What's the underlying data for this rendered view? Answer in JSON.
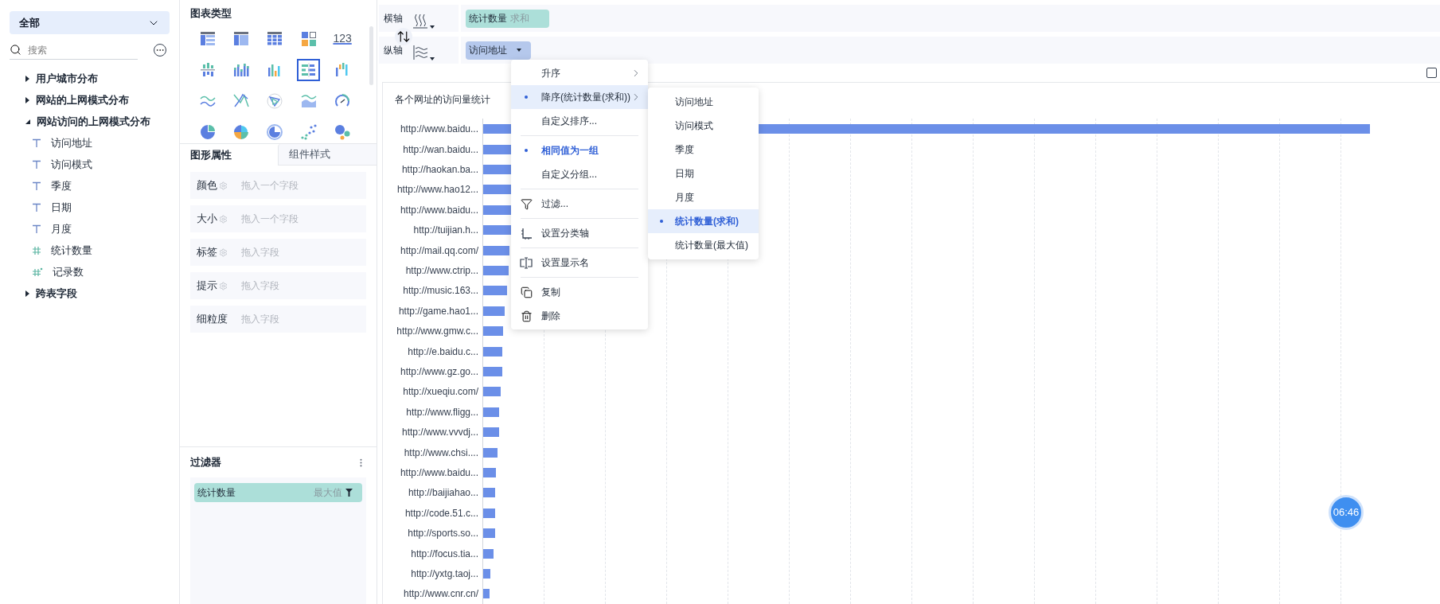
{
  "sidebar": {
    "dropdown": "全部",
    "search": {
      "placeholder": "搜索"
    },
    "tree": [
      {
        "label": "用户城市分布",
        "expanded": false
      },
      {
        "label": "网站的上网模式分布",
        "expanded": false
      },
      {
        "label": "网站访问的上网模式分布",
        "expanded": true,
        "children": [
          {
            "label": "访问地址",
            "kind": "text"
          },
          {
            "label": "访问模式",
            "kind": "text"
          },
          {
            "label": "季度",
            "kind": "text"
          },
          {
            "label": "日期",
            "kind": "text"
          },
          {
            "label": "月度",
            "kind": "text"
          },
          {
            "label": "统计数量",
            "kind": "number"
          },
          {
            "label": "记录数",
            "kind": "calc"
          }
        ]
      },
      {
        "label": "跨表字段",
        "expanded": false
      }
    ]
  },
  "chart_types": {
    "title": "图表类型",
    "items": [
      {
        "kind": "table",
        "selected": false
      },
      {
        "kind": "pivot",
        "selected": false
      },
      {
        "kind": "grid",
        "selected": false
      },
      {
        "kind": "tiles",
        "selected": false
      },
      {
        "kind": "number",
        "text": "123",
        "selected": false
      },
      {
        "kind": "bar-split",
        "selected": false
      },
      {
        "kind": "bar-stack",
        "selected": false
      },
      {
        "kind": "bar",
        "selected": false
      },
      {
        "kind": "hbar",
        "selected": true
      },
      {
        "kind": "waterfall",
        "selected": false
      },
      {
        "kind": "line",
        "selected": false
      },
      {
        "kind": "cross-line",
        "selected": false
      },
      {
        "kind": "radar",
        "selected": false
      },
      {
        "kind": "area",
        "selected": false
      },
      {
        "kind": "gauge",
        "selected": false
      },
      {
        "kind": "pie",
        "selected": false
      },
      {
        "kind": "rose",
        "selected": false
      },
      {
        "kind": "ring",
        "selected": false
      },
      {
        "kind": "scatter",
        "selected": false
      },
      {
        "kind": "bubble",
        "selected": false
      }
    ]
  },
  "tabs": [
    {
      "label": "图形属性",
      "selected": true
    },
    {
      "label": "组件样式",
      "selected": false
    }
  ],
  "properties": [
    {
      "label": "颜色",
      "settings": true,
      "placeholder": "拖入一个字段"
    },
    {
      "label": "大小",
      "settings": true,
      "placeholder": "拖入一个字段"
    },
    {
      "label": "标签",
      "settings": true,
      "placeholder": "拖入字段"
    },
    {
      "label": "提示",
      "settings": true,
      "placeholder": "拖入字段"
    },
    {
      "label": "细粒度",
      "settings": false,
      "placeholder": "拖入字段"
    }
  ],
  "filter": {
    "title": "过滤器",
    "items": [
      {
        "field": "统计数量",
        "aggregate": "最大值"
      }
    ]
  },
  "checkbox": {
    "checked": false
  },
  "axes": [
    {
      "label": "横轴",
      "pill": {
        "kind": "measure",
        "field": "统计数量",
        "aggregate": "求和"
      }
    },
    {
      "label": "纵轴",
      "pill": {
        "kind": "dimension",
        "field": "访问地址"
      }
    }
  ],
  "chart": {
    "title": "各个网址的访问量统计",
    "labels": [
      "http://www.baidu...",
      "http://wan.baidu...",
      "http://haokan.ba...",
      "http://www.hao12...",
      "http://www.baidu...",
      "http://tuijian.h...",
      "http://mail.qq.com/",
      "http://www.ctrip...",
      "http://music.163...",
      "http://game.hao1...",
      "http://www.gmw.c...",
      "http://e.baidu.c...",
      "http://www.gz.go...",
      "http://xueqiu.com/",
      "http://www.fligg...",
      "http://www.vvvdj...",
      "http://www.chsi....",
      "http://www.baidu...",
      "http://baijiahao...",
      "http://code.51.c...",
      "http://sports.so...",
      "http://focus.tia...",
      "http://yxtg.taoj...",
      "http://www.cnr.cn/"
    ]
  },
  "context_menu": {
    "sections": [
      [
        {
          "label": "升序",
          "checked": false,
          "active": false,
          "highlighted": false,
          "submenu": true
        },
        {
          "label": "降序(统计数量(求和))",
          "checked": true,
          "active": false,
          "highlighted": true,
          "submenu": true
        },
        {
          "label": "自定义排序...",
          "checked": false,
          "active": false,
          "highlighted": false,
          "submenu": false
        }
      ],
      [
        {
          "label": "相同值为一组",
          "checked": true,
          "active": true,
          "highlighted": false,
          "submenu": false
        },
        {
          "label": "自定义分组...",
          "checked": false,
          "active": false,
          "highlighted": false,
          "submenu": false
        }
      ],
      [
        {
          "label": "过滤...",
          "kind": "filter",
          "checked": false,
          "active": false,
          "highlighted": false,
          "submenu": false
        }
      ],
      [
        {
          "label": "设置分类轴",
          "kind": "axis",
          "checked": false,
          "active": false,
          "highlighted": false,
          "submenu": false
        }
      ],
      [
        {
          "label": "设置显示名",
          "kind": "rename",
          "checked": false,
          "active": false,
          "highlighted": false,
          "submenu": false
        }
      ],
      [
        {
          "label": "复制",
          "kind": "copy",
          "checked": false,
          "active": false,
          "highlighted": false,
          "submenu": false
        },
        {
          "label": "删除",
          "kind": "delete",
          "checked": false,
          "active": false,
          "highlighted": false,
          "submenu": false
        }
      ]
    ],
    "submenu": [
      {
        "label": "访问地址",
        "selected": false
      },
      {
        "label": "访问模式",
        "selected": false
      },
      {
        "label": "季度",
        "selected": false
      },
      {
        "label": "日期",
        "selected": false
      },
      {
        "label": "月度",
        "selected": false
      },
      {
        "label": "统计数量(求和)",
        "selected": true
      },
      {
        "label": "统计数量(最大值)",
        "selected": false
      }
    ]
  },
  "timer": "06:46"
}
